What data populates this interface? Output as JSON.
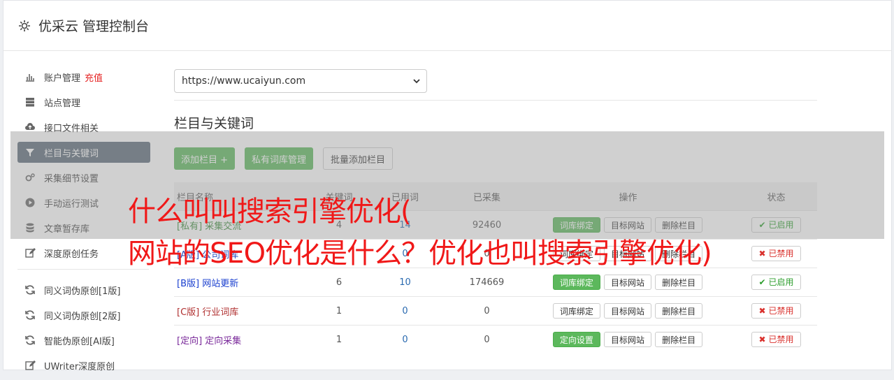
{
  "header": {
    "icon": "gear-icon",
    "title": "优采云 管理控制台"
  },
  "sidebar": {
    "items": [
      {
        "icon": "bar-chart-icon",
        "label": "账户管理",
        "badge": "充值",
        "active": false
      },
      {
        "icon": "server-icon",
        "label": "站点管理",
        "active": false
      },
      {
        "icon": "cloud-upload-icon",
        "label": "接口文件相关",
        "active": false
      },
      {
        "icon": "filter-icon",
        "label": "栏目与关键词",
        "active": true
      },
      {
        "icon": "cogs-icon",
        "label": "采集细节设置",
        "active": false
      },
      {
        "icon": "play-circle-icon",
        "label": "手动运行测试",
        "active": false
      },
      {
        "icon": "database-icon",
        "label": "文章暂存库",
        "active": false
      },
      {
        "icon": "edit-icon",
        "label": "深度原创任务",
        "active": false
      }
    ],
    "items2": [
      {
        "icon": "refresh-icon",
        "label": "同义词伪原创[1版]"
      },
      {
        "icon": "refresh-icon",
        "label": "同义词伪原创[2版]"
      },
      {
        "icon": "refresh-icon",
        "label": "智能伪原创[AI版]"
      },
      {
        "icon": "edit-icon",
        "label": "UWriter深度原创"
      }
    ]
  },
  "main": {
    "site_select": "https://www.ucaiyun.com",
    "section_title": "栏目与关键词",
    "buttons": {
      "add_column": "添加栏目 +",
      "private_lib": "私有词库管理",
      "batch_add": "批量添加栏目"
    },
    "table": {
      "headers": [
        "栏目名称",
        "关键词",
        "已用词",
        "已采集",
        "操作",
        "状态"
      ],
      "rows": [
        {
          "tag": "[私有]",
          "name": "采集交流",
          "color": "#3c8c3c",
          "c1": "4",
          "c2": "14",
          "c3": "92460",
          "op1": "词库绑定",
          "op1_green": true,
          "op2": "目标网站",
          "op3": "删除栏目",
          "status": "已启用",
          "status_on": true
        },
        {
          "tag": "[A版]",
          "name": "公司词库",
          "color": "#2a4fbf",
          "c1": "",
          "c2": "0",
          "c3": "0",
          "op1": "词库绑定",
          "op1_green": false,
          "op2": "目标网站",
          "op3": "删除栏目",
          "status": "已禁用",
          "status_on": false
        },
        {
          "tag": "[B版]",
          "name": "网站更新",
          "color": "#1a3fcf",
          "c1": "6",
          "c2": "10",
          "c3": "174669",
          "op1": "词库绑定",
          "op1_green": true,
          "op2": "目标网站",
          "op3": "删除栏目",
          "status": "已启用",
          "status_on": true
        },
        {
          "tag": "[C版]",
          "name": "行业词库",
          "color": "#b03030",
          "c1": "1",
          "c2": "0",
          "c3": "0",
          "op1": "词库绑定",
          "op1_green": false,
          "op2": "目标网站",
          "op3": "删除栏目",
          "status": "已禁用",
          "status_on": false
        },
        {
          "tag": "[定向]",
          "name": "定向采集",
          "color": "#7a2a9a",
          "c1": "1",
          "c2": "0",
          "c3": "0",
          "op1": "定向设置",
          "op1_green": true,
          "op2": "目标网站",
          "op3": "删除栏目",
          "status": "已禁用",
          "status_on": false
        }
      ]
    }
  },
  "overlay": {
    "line1": "什么叫叫搜索引擎优化(",
    "line2": "网站的SEO优化是什么？优化也叫搜索引擎优化)"
  }
}
